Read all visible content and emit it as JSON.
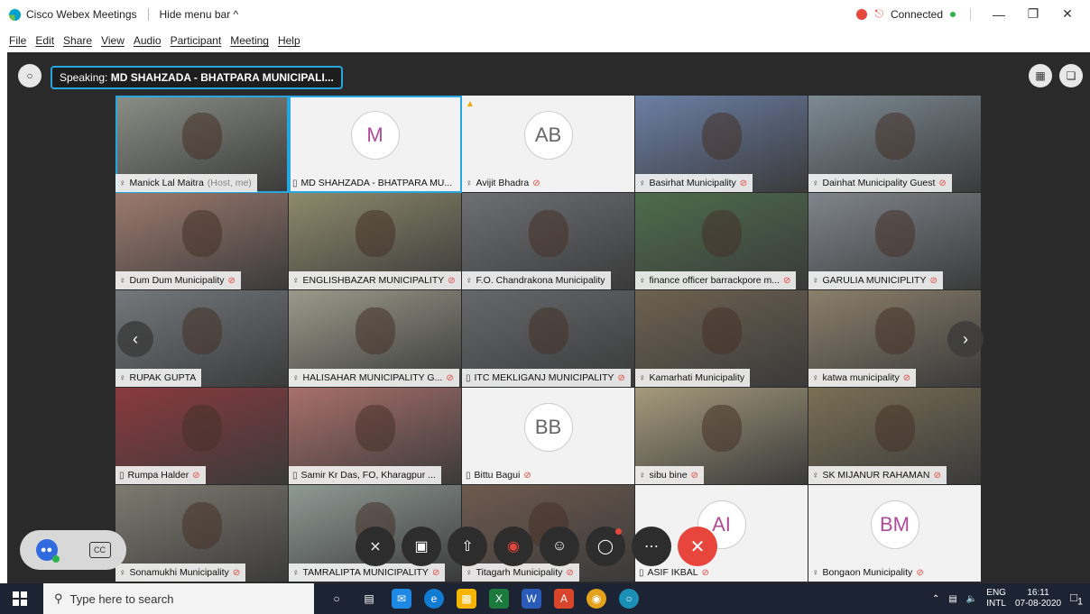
{
  "titlebar": {
    "app_title": "Cisco Webex Meetings",
    "hide_menu": "Hide menu bar ^",
    "status": "Connected"
  },
  "menu": [
    "File",
    "Edit",
    "Share",
    "View",
    "Audio",
    "Participant",
    "Meeting",
    "Help"
  ],
  "speaking": {
    "label": "Speaking:",
    "name": "MD SHAHZADA - BHATPARA MUNICIPALI..."
  },
  "tiles": [
    {
      "name": "Manick Lal Maitra",
      "suffix": "(Host, me)",
      "type": "video",
      "bg": "#8a8f86",
      "icon": "audio",
      "muted": false,
      "active": true
    },
    {
      "name": "MD SHAHZADA - BHATPARA MU...",
      "type": "avatar",
      "initials": "M",
      "icon": "device",
      "muted": false,
      "active": true,
      "pink": true
    },
    {
      "name": "Avijit Bhadra",
      "type": "avatar",
      "initials": "AB",
      "icon": "audio",
      "muted": true,
      "warn": true
    },
    {
      "name": "Basirhat Municipality",
      "type": "video",
      "bg": "#6b7fa5",
      "icon": "audio",
      "muted": true
    },
    {
      "name": "Dainhat Municipality Guest",
      "type": "video",
      "bg": "#7c8a93",
      "icon": "audio",
      "muted": true
    },
    {
      "name": "Dum Dum Municipality",
      "type": "video",
      "bg": "#9c7a6e",
      "icon": "audio",
      "muted": true
    },
    {
      "name": "ENGLISHBAZAR MUNICIPALITY",
      "type": "video",
      "bg": "#8d8a6b",
      "icon": "audio",
      "muted": true
    },
    {
      "name": "F.O. Chandrakona Municipality",
      "type": "video",
      "bg": "#6d6f73",
      "icon": "audio",
      "muted": false
    },
    {
      "name": "finance officer barrackpore m...",
      "type": "video",
      "bg": "#4d6d4c",
      "icon": "audio",
      "muted": true
    },
    {
      "name": "GARULIA MUNICIPLITY",
      "type": "video",
      "bg": "#7f858c",
      "icon": "audio",
      "muted": true
    },
    {
      "name": "RUPAK GUPTA",
      "type": "video",
      "bg": "#73787c",
      "icon": "audio",
      "muted": false
    },
    {
      "name": "HALISAHAR MUNICIPALITY G...",
      "type": "video",
      "bg": "#9a9a8a",
      "icon": "audio",
      "muted": true
    },
    {
      "name": "ITC MEKLIGANJ MUNICIPALITY",
      "type": "video",
      "bg": "#65686a",
      "icon": "device",
      "muted": true
    },
    {
      "name": "Kamarhati Municipality",
      "type": "video",
      "bg": "#6e6250",
      "icon": "audio",
      "muted": false
    },
    {
      "name": "katwa municipality",
      "type": "video",
      "bg": "#8b7f6b",
      "icon": "audio",
      "muted": true
    },
    {
      "name": "Rumpa Halder",
      "type": "video",
      "bg": "#8a3a3e",
      "icon": "device",
      "muted": true
    },
    {
      "name": "Samir Kr Das, FO, Kharagpur ...",
      "type": "video",
      "bg": "#a9706b",
      "icon": "device",
      "muted": false
    },
    {
      "name": "Bittu Bagui",
      "type": "avatar",
      "initials": "BB",
      "icon": "device",
      "muted": true
    },
    {
      "name": "sibu bine",
      "type": "video",
      "bg": "#a59a7c",
      "icon": "audio",
      "muted": true
    },
    {
      "name": "SK MIJANUR RAHAMAN",
      "type": "video",
      "bg": "#7a6f55",
      "icon": "audio",
      "muted": true
    },
    {
      "name": "Sonamukhi Municipality",
      "type": "video",
      "bg": "#7e7a70",
      "icon": "audio",
      "muted": true
    },
    {
      "name": "TAMRALIPTA MUNICIPALITY",
      "type": "video",
      "bg": "#8f9a95",
      "icon": "audio",
      "muted": true
    },
    {
      "name": "Titagarh Municipality",
      "type": "video",
      "bg": "#6e5a4e",
      "icon": "audio",
      "muted": true
    },
    {
      "name": "ASIF IKBAL",
      "type": "avatar",
      "initials": "AI",
      "icon": "device",
      "muted": true,
      "pink": true
    },
    {
      "name": "Bongaon Municipality",
      "type": "avatar",
      "initials": "BM",
      "icon": "audio",
      "muted": true,
      "pink": true
    }
  ],
  "taskbar": {
    "search_placeholder": "Type here to search",
    "lang_top": "ENG",
    "lang_bottom": "INTL",
    "time": "16:11",
    "date": "07-08-2020",
    "notifications": "1"
  },
  "colors": {
    "accent": "#27a6e0",
    "end_call": "#e8453c",
    "stage_bg": "#2a2a2a"
  }
}
